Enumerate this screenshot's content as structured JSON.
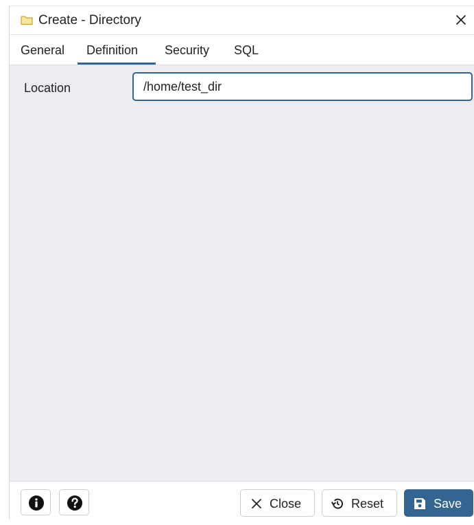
{
  "dialog": {
    "title": "Create - Directory",
    "close_glyph": "✕",
    "title_icon": "folder-icon"
  },
  "tabs": [
    {
      "label": "General",
      "active": false
    },
    {
      "label": "Definition",
      "active": true
    },
    {
      "label": "Security",
      "active": false
    },
    {
      "label": "SQL",
      "active": false
    }
  ],
  "definition": {
    "location_label": "Location",
    "location_value": "/home/test_dir"
  },
  "footer": {
    "info_icon": "info-icon",
    "help_icon": "help-icon",
    "close_label": "Close",
    "reset_label": "Reset",
    "save_label": "Save"
  },
  "colors": {
    "accent": "#326690",
    "body_bg": "#ebedf0",
    "folder_fill": "#f7e59a",
    "folder_stroke": "#caa52a"
  }
}
